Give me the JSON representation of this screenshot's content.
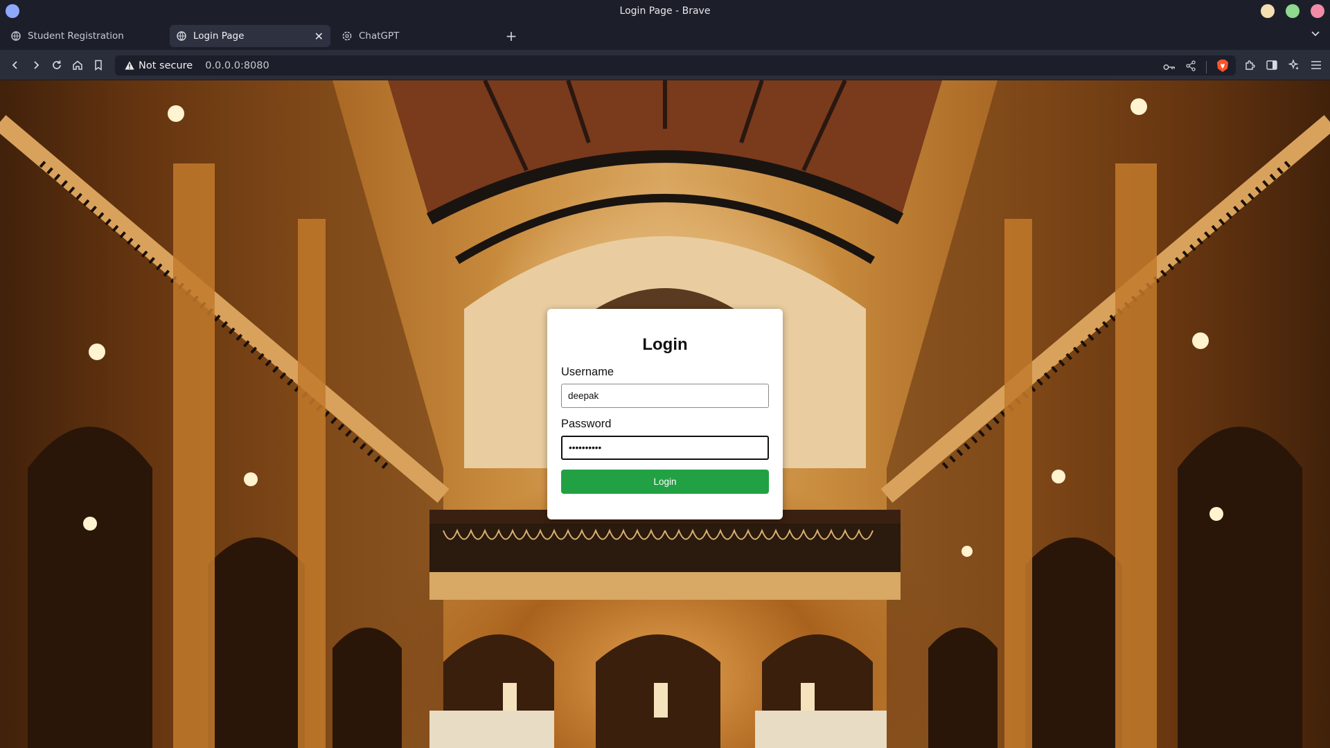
{
  "window": {
    "title": "Login Page - Brave",
    "colors": {
      "close": "#f28ba8",
      "maximize": "#8fd98f",
      "minimize": "#f5deb0",
      "app": "#8fa8ff"
    }
  },
  "tabs": [
    {
      "label": "Student Registration",
      "icon": "globe-icon",
      "active": false
    },
    {
      "label": "Login Page",
      "icon": "globe-icon",
      "active": true
    },
    {
      "label": "ChatGPT",
      "icon": "openai-icon",
      "active": false
    }
  ],
  "address_bar": {
    "security_label": "Not secure",
    "url": "0.0.0.0:8080"
  },
  "login_form": {
    "title": "Login",
    "username_label": "Username",
    "username_value": "deepak",
    "password_label": "Password",
    "password_value": "••••••••••",
    "submit_label": "Login",
    "accent_color": "#22a144"
  }
}
